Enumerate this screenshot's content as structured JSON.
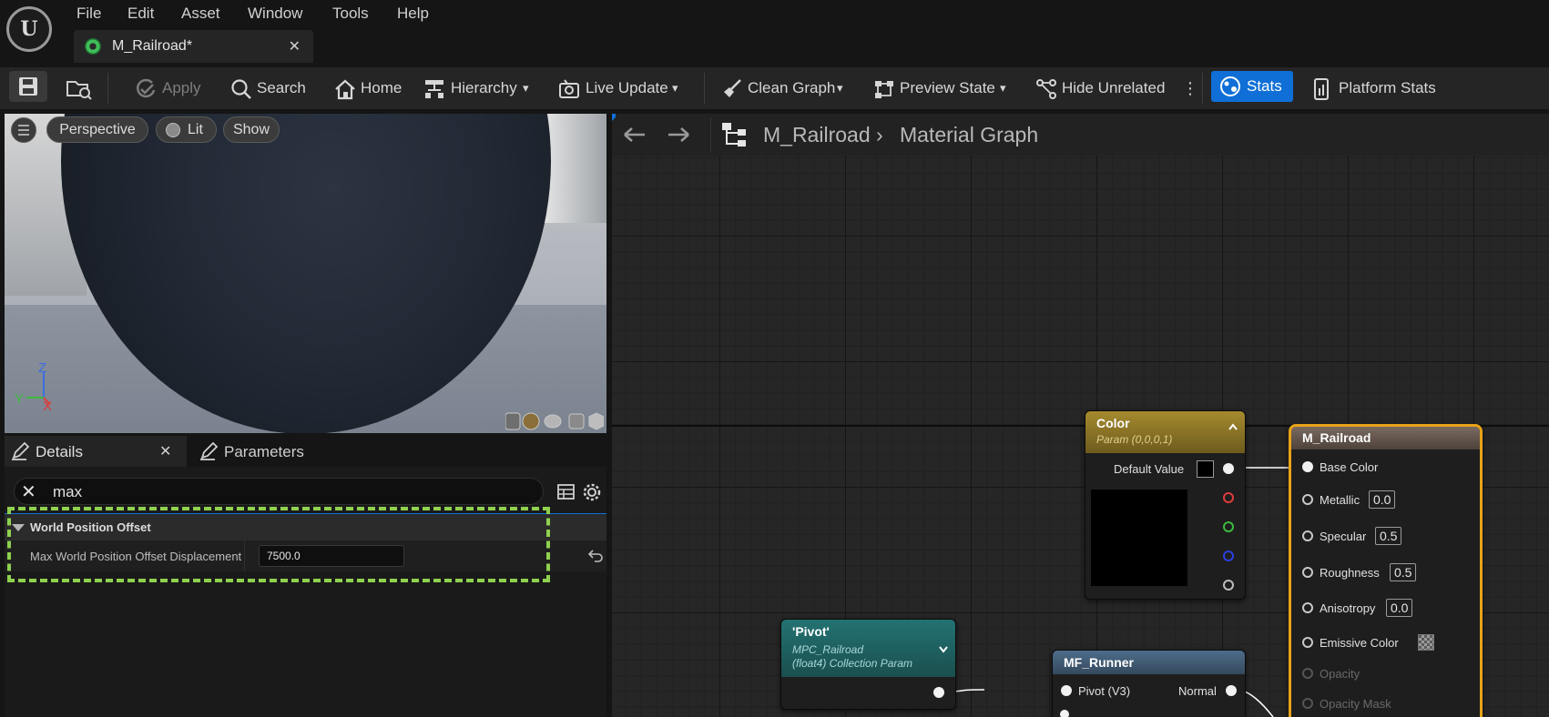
{
  "menu": {
    "items": [
      "File",
      "Edit",
      "Asset",
      "Window",
      "Tools",
      "Help"
    ]
  },
  "document_tab": {
    "label": "M_Railroad*"
  },
  "toolbar": {
    "apply": "Apply",
    "search": "Search",
    "home": "Home",
    "hierarchy": "Hierarchy",
    "live_update": "Live Update",
    "clean_graph": "Clean Graph",
    "preview_state": "Preview State",
    "hide_unrelated": "Hide Unrelated",
    "stats": "Stats",
    "platform_stats": "Platform Stats",
    "accent_color": "#0f6fd6"
  },
  "viewport": {
    "perspective": "Perspective",
    "lit": "Lit",
    "show": "Show",
    "axis_z": "Z",
    "axis_y": "Y",
    "axis_x": "X"
  },
  "panels": {
    "details_tab": "Details",
    "parameters_tab": "Parameters",
    "filter_value": "max",
    "section": "World Position Offset",
    "property_label": "Max World Position Offset Displacement",
    "property_value": "7500.0",
    "highlight_color": "#8fd14f"
  },
  "graph": {
    "breadcrumb_asset": "M_Railroad",
    "breadcrumb_sep": "›",
    "breadcrumb_graph": "Material Graph",
    "color_node": {
      "title": "Color",
      "subtitle": "Param (0,0,0,1)",
      "default_value_label": "Default Value",
      "head_color": "#8b7424"
    },
    "pivot_node": {
      "title": "'Pivot'",
      "subtitle1": "MPC_Railroad",
      "subtitle2": "(float4) Collection Param",
      "head_color": "#1d5e5e"
    },
    "mf_node": {
      "title": "MF_Runner",
      "pin_in": "Pivot (V3)",
      "pin_out": "Normal",
      "head_color": "#3f5a73"
    },
    "result_node": {
      "title": "M_Railroad",
      "border_color": "#e8a317",
      "pins": [
        {
          "label": "Base Color",
          "value": ""
        },
        {
          "label": "Metallic",
          "value": "0.0"
        },
        {
          "label": "Specular",
          "value": "0.5"
        },
        {
          "label": "Roughness",
          "value": "0.5"
        },
        {
          "label": "Anisotropy",
          "value": "0.0"
        },
        {
          "label": "Emissive Color",
          "value": ""
        },
        {
          "label": "Opacity",
          "value": ""
        },
        {
          "label": "Opacity Mask",
          "value": ""
        }
      ]
    }
  }
}
